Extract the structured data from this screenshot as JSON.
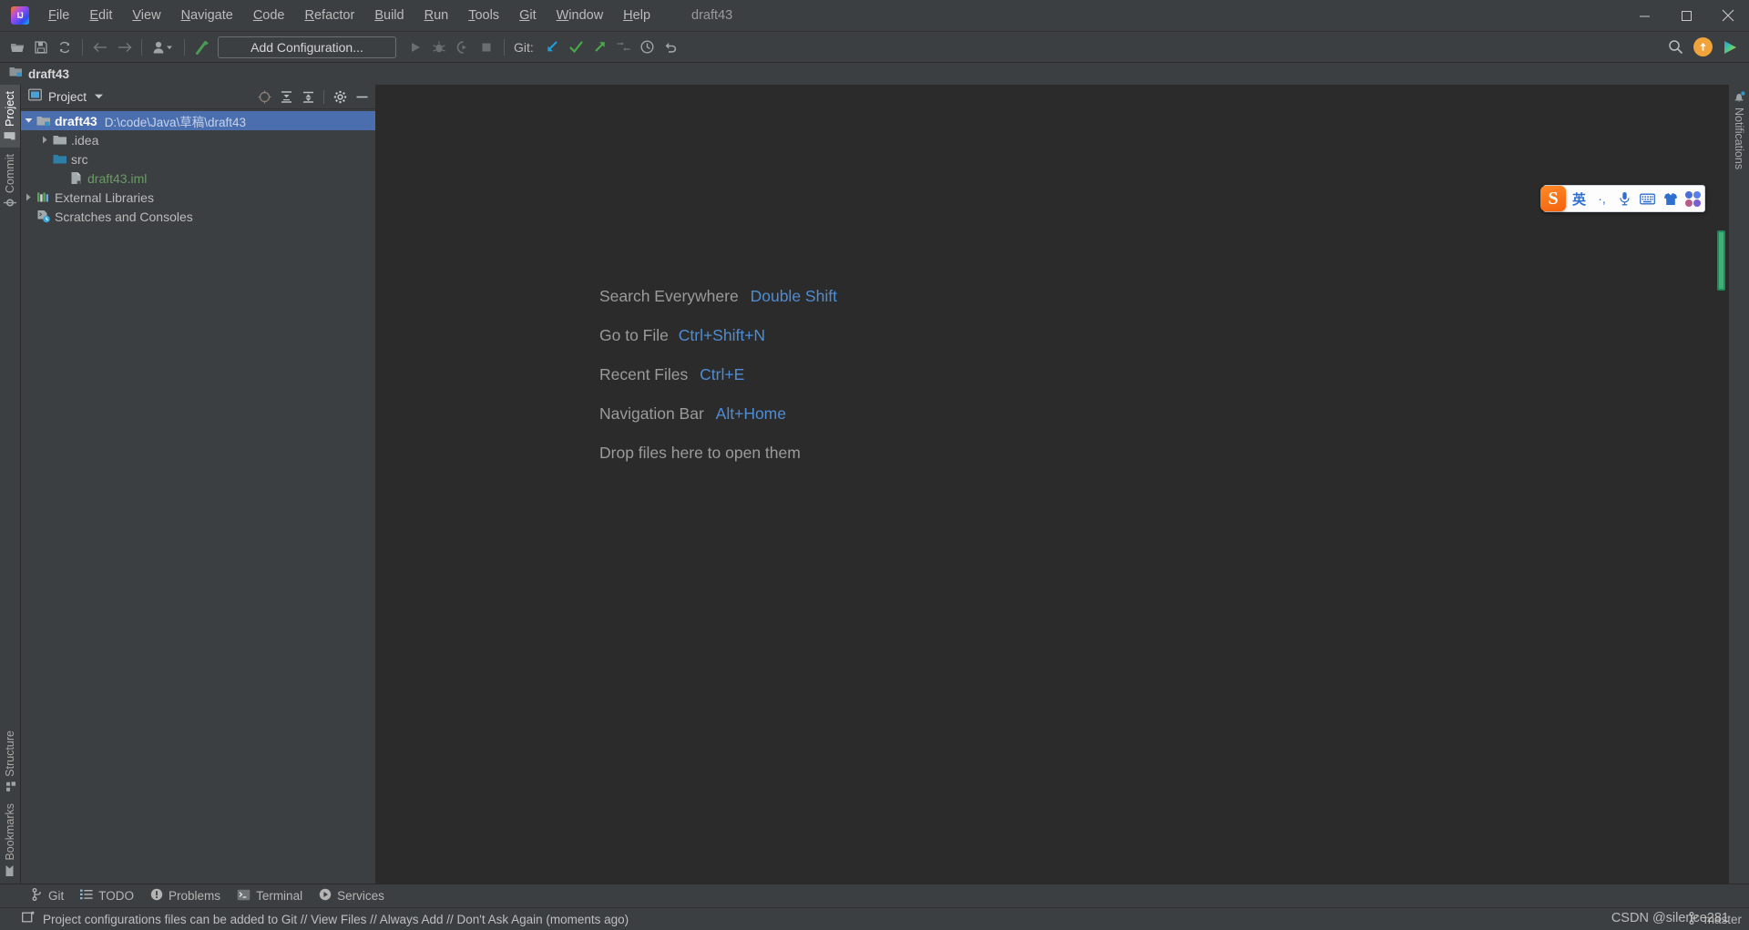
{
  "window": {
    "title": "draft43",
    "minimize_label": "Minimize",
    "maximize_label": "Maximize",
    "close_label": "Close"
  },
  "menubar": [
    {
      "label": "File",
      "mnemonic": "F"
    },
    {
      "label": "Edit",
      "mnemonic": "E"
    },
    {
      "label": "View",
      "mnemonic": "V"
    },
    {
      "label": "Navigate",
      "mnemonic": "N"
    },
    {
      "label": "Code",
      "mnemonic": "C"
    },
    {
      "label": "Refactor",
      "mnemonic": "R"
    },
    {
      "label": "Build",
      "mnemonic": "B"
    },
    {
      "label": "Run",
      "mnemonic": "R"
    },
    {
      "label": "Tools",
      "mnemonic": "T"
    },
    {
      "label": "Git",
      "mnemonic": "G"
    },
    {
      "label": "Window",
      "mnemonic": "W"
    },
    {
      "label": "Help",
      "mnemonic": "H"
    }
  ],
  "toolbar": {
    "open_label": "Open",
    "save_all_label": "Save All",
    "sync_label": "Reload All from Disk",
    "back_label": "Back",
    "forward_label": "Forward",
    "profile_label": "Profile",
    "build_label": "Build Project",
    "run_config": "Add Configuration...",
    "run_label": "Run",
    "debug_label": "Debug",
    "run_coverage_label": "Run with Coverage",
    "stop_label": "Stop",
    "git_label": "Git:",
    "git_update_label": "Update Project",
    "git_commit_label": "Commit",
    "git_push_label": "Push",
    "git_branch_label": "Branches",
    "git_history_label": "Show History",
    "git_rollback_label": "Rollback",
    "search_label": "Search Everywhere",
    "updates_label": "IDE and Plugin Updates",
    "code_with_me_label": "Code With Me"
  },
  "navbar": {
    "project_name": "draft43"
  },
  "left_stripe": {
    "top": [
      {
        "label": "Project",
        "icon": "project-folder-icon",
        "active": true
      },
      {
        "label": "Commit",
        "icon": "commit-node-icon",
        "active": false
      }
    ],
    "bottom": [
      {
        "label": "Structure",
        "icon": "structure-icon",
        "active": false
      },
      {
        "label": "Bookmarks",
        "icon": "bookmark-icon",
        "active": false
      }
    ]
  },
  "right_stripe": {
    "items": [
      {
        "label": "Notifications",
        "icon": "bell-icon",
        "active": false
      }
    ]
  },
  "project_panel": {
    "title": "Project",
    "view_icon": "project-view-icon",
    "dropdown_icon": "chevron-down-icon",
    "actions": [
      {
        "name": "select-opened-file-icon",
        "label": "Select Opened File"
      },
      {
        "name": "expand-all-icon",
        "label": "Expand All"
      },
      {
        "name": "collapse-all-icon",
        "label": "Collapse All"
      },
      {
        "name": "gear-icon",
        "label": "Options"
      },
      {
        "name": "hide-icon",
        "label": "Hide"
      }
    ],
    "tree": [
      {
        "label": "draft43",
        "path": "D:\\code\\Java\\草稿\\draft43",
        "icon": "module-folder-icon",
        "indent": 0,
        "twisty": "expanded",
        "selected": true,
        "bold": true,
        "color": "default"
      },
      {
        "label": ".idea",
        "path": "",
        "icon": "folder-icon",
        "indent": 1,
        "twisty": "collapsed",
        "selected": false,
        "bold": false,
        "color": "default"
      },
      {
        "label": "src",
        "path": "",
        "icon": "source-folder-icon",
        "indent": 1,
        "twisty": "none",
        "selected": false,
        "bold": false,
        "color": "default"
      },
      {
        "label": "draft43.iml",
        "path": "",
        "icon": "iml-file-icon",
        "indent": 2,
        "twisty": "none",
        "selected": false,
        "bold": false,
        "color": "green"
      },
      {
        "label": "External Libraries",
        "path": "",
        "icon": "libraries-icon",
        "indent": 0,
        "twisty": "collapsed",
        "selected": false,
        "bold": false,
        "color": "default"
      },
      {
        "label": "Scratches and Consoles",
        "path": "",
        "icon": "scratches-icon",
        "indent": 0,
        "twisty": "none",
        "selected": false,
        "bold": false,
        "color": "default"
      }
    ]
  },
  "editor": {
    "welcome_rows": [
      {
        "action": "Search Everywhere",
        "shortcut": "Double Shift"
      },
      {
        "action": "Go to File",
        "shortcut": "Ctrl+Shift+N"
      },
      {
        "action": "Recent Files",
        "shortcut": "Ctrl+E"
      },
      {
        "action": "Navigation Bar",
        "shortcut": "Alt+Home"
      },
      {
        "action": "Drop files here to open them",
        "shortcut": ""
      }
    ],
    "marker_color": "#3cb371"
  },
  "ime": {
    "logo_char": "S",
    "buttons": [
      {
        "name": "ime-mode-english",
        "label": "英"
      },
      {
        "name": "ime-punctuation",
        "label": "·,"
      },
      {
        "name": "ime-voice-input-icon",
        "label": ""
      },
      {
        "name": "ime-soft-keyboard-icon",
        "label": ""
      },
      {
        "name": "ime-skin-icon",
        "label": ""
      },
      {
        "name": "ime-toolbox-icon",
        "label": ""
      }
    ]
  },
  "tool_window_bar": [
    {
      "label": "Git",
      "icon": "git-branch-icon"
    },
    {
      "label": "TODO",
      "icon": "todo-list-icon"
    },
    {
      "label": "Problems",
      "icon": "problems-icon"
    },
    {
      "label": "Terminal",
      "icon": "terminal-icon"
    },
    {
      "label": "Services",
      "icon": "services-play-icon"
    }
  ],
  "statusbar": {
    "message": "Project configurations files can be added to Git // View Files // Always Add // Don't Ask Again (moments ago)",
    "message_icon": "event-log-icon",
    "branch": "master",
    "branch_icon": "git-branch-icon",
    "watermark": "CSDN @silence281"
  },
  "colors": {
    "accent_blue": "#4e8dd4",
    "selection_blue": "#4b6eaf",
    "panel_bg": "#3c3f41",
    "editor_bg": "#2b2b2b",
    "green_file": "#6a9d62",
    "git_push_green": "#49a84b",
    "git_update_blue": "#1d9ed9",
    "ime_orange": "#f4610d"
  }
}
